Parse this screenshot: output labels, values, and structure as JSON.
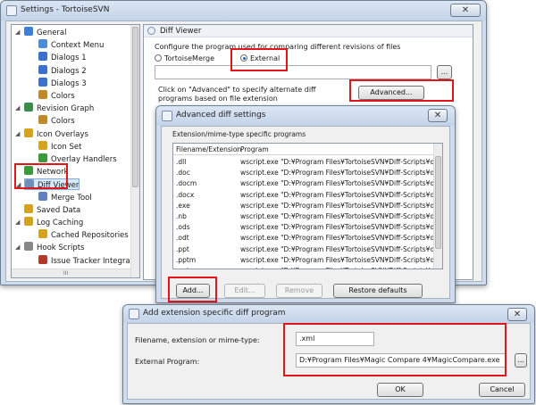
{
  "settings_window": {
    "title": "Settings - TortoiseSVN",
    "tree": [
      {
        "label": "General",
        "color": "#3d7fd6",
        "expander": "◢"
      },
      {
        "label": "Context Menu",
        "color": "#4b8bd8"
      },
      {
        "label": "Dialogs 1",
        "color": "#3b6fd0"
      },
      {
        "label": "Dialogs 2",
        "color": "#3b6fd0"
      },
      {
        "label": "Dialogs 3",
        "color": "#3b6fd0"
      },
      {
        "label": "Colors",
        "color": "#c08a2a"
      },
      {
        "label": "Revision Graph",
        "color": "#3a8d4a",
        "expander": "◢"
      },
      {
        "label": "Colors",
        "color": "#c08a2a"
      },
      {
        "label": "Icon Overlays",
        "color": "#d6a321",
        "expander": "◢"
      },
      {
        "label": "Icon Set",
        "color": "#d6a321"
      },
      {
        "label": "Overlay Handlers",
        "color": "#3a9a3a"
      },
      {
        "label": "Network",
        "color": "#3a9a3a"
      },
      {
        "label": "Diff Viewer",
        "color": "#6e8fb8",
        "expander": "◢"
      },
      {
        "label": "Merge Tool",
        "color": "#5f7fbf"
      },
      {
        "label": "Saved Data",
        "color": "#d6a321"
      },
      {
        "label": "Log Caching",
        "color": "#d6a321",
        "expander": "◢"
      },
      {
        "label": "Cached Repositories",
        "color": "#d6a321"
      },
      {
        "label": "Hook Scripts",
        "color": "#888888",
        "expander": "◢"
      },
      {
        "label": "Issue Tracker Integrat",
        "color": "#b23a2a"
      }
    ],
    "hscroll_glyph": "III",
    "section_title": "Diff Viewer",
    "configure_text": "Configure the program used for comparing different revisions of files",
    "radio_tortoisemerge": "TortoiseMerge",
    "radio_external": "External",
    "ellipsis": "...",
    "advanced_hint": "Click on \"Advanced\" to specify alternate diff programs based on file extension",
    "advanced_button": "Advanced..."
  },
  "advanced_dialog": {
    "title": "Advanced diff settings",
    "group_label": "Extension/mime-type specific programs",
    "columns": [
      "Filename/Extension",
      "Program"
    ],
    "rows": [
      {
        "ext": ".dll",
        "program": "wscript.exe \"D:¥Program Files¥TortoiseSVN¥Diff-Scripts¥diff-d..."
      },
      {
        "ext": ".doc",
        "program": "wscript.exe \"D:¥Program Files¥TortoiseSVN¥Diff-Scripts¥diff-d..."
      },
      {
        "ext": ".docm",
        "program": "wscript.exe \"D:¥Program Files¥TortoiseSVN¥Diff-Scripts¥diff-d..."
      },
      {
        "ext": ".docx",
        "program": "wscript.exe \"D:¥Program Files¥TortoiseSVN¥Diff-Scripts¥diff-d..."
      },
      {
        "ext": ".exe",
        "program": "wscript.exe \"D:¥Program Files¥TortoiseSVN¥Diff-Scripts¥diff-d..."
      },
      {
        "ext": ".nb",
        "program": "wscript.exe \"D:¥Program Files¥TortoiseSVN¥Diff-Scripts¥diff-n..."
      },
      {
        "ext": ".ods",
        "program": "wscript.exe \"D:¥Program Files¥TortoiseSVN¥Diff-Scripts¥diff-o..."
      },
      {
        "ext": ".odt",
        "program": "wscript.exe \"D:¥Program Files¥TortoiseSVN¥Diff-Scripts¥diff-o..."
      },
      {
        "ext": ".ppt",
        "program": "wscript.exe \"D:¥Program Files¥TortoiseSVN¥Diff-Scripts¥diff-p..."
      },
      {
        "ext": ".pptm",
        "program": "wscript.exe \"D:¥Program Files¥TortoiseSVN¥Diff-Scripts¥diff-p..."
      },
      {
        "ext": ".pptx",
        "program": "wscript.exe \"D:¥Program Files¥TortoiseSVN¥Diff-Scripts¥diff-p..."
      }
    ],
    "add_button": "Add...",
    "edit_button": "Edit...",
    "remove_button": "Remove",
    "restore_button": "Restore defaults"
  },
  "add_dialog": {
    "title": "Add extension specific diff program",
    "ext_label": "Filename, extension or mime-type:",
    "ext_value": ".xml",
    "program_label": "External Program:",
    "program_value": "D:¥Program Files¥Magic Compare 4¥MagicCompare.exe",
    "browse": "...",
    "ok": "OK",
    "cancel": "Cancel"
  },
  "close_glyph": "✕"
}
